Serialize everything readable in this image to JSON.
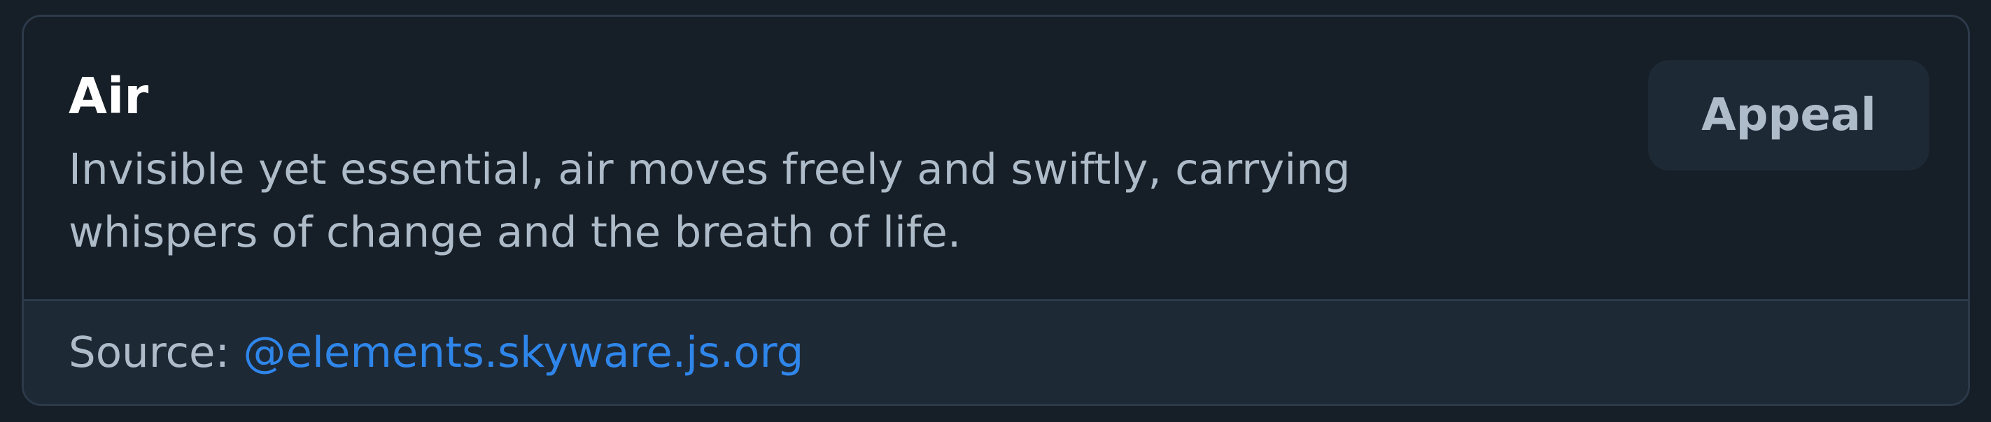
{
  "card": {
    "title": "Air",
    "description": "Invisible yet essential, air moves freely and swiftly, carrying whispers of change and the breath of life.",
    "action_label": "Appeal",
    "source_label": "Source: ",
    "source_link": "@elements.skyware.js.org"
  },
  "colors": {
    "background": "#161e27",
    "footer_background": "#1e2936",
    "border": "#2c3a4a",
    "title_text": "#ffffff",
    "body_text": "#aebbc9",
    "link": "#2f86ea"
  }
}
